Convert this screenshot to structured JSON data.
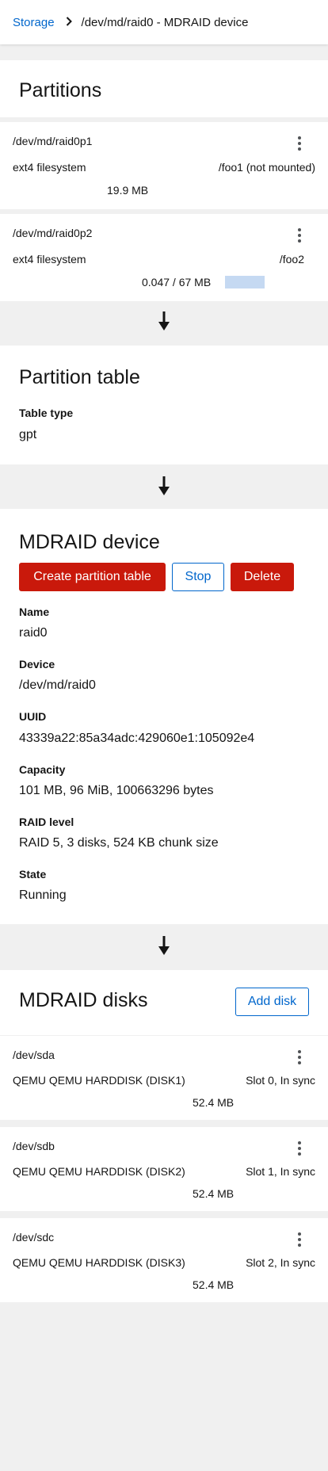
{
  "breadcrumb": {
    "root": "Storage",
    "current": "/dev/md/raid0 - MDRAID device"
  },
  "partitions": {
    "title": "Partitions",
    "items": [
      {
        "name": "/dev/md/raid0p1",
        "type": "ext4 filesystem",
        "mount": "/foo1 (not mounted)",
        "size": "19.9 MB",
        "usage": null
      },
      {
        "name": "/dev/md/raid0p2",
        "type": "ext4 filesystem",
        "mount": "/foo2",
        "size": "0.047 / 67 MB",
        "usage": 0.001
      }
    ]
  },
  "partition_table": {
    "title": "Partition table",
    "type_label": "Table type",
    "type_value": "gpt"
  },
  "mdraid_device": {
    "title": "MDRAID device",
    "buttons": {
      "create": "Create partition table",
      "stop": "Stop",
      "delete": "Delete"
    },
    "fields": [
      {
        "label": "Name",
        "value": "raid0"
      },
      {
        "label": "Device",
        "value": "/dev/md/raid0"
      },
      {
        "label": "UUID",
        "value": "43339a22:85a34adc:429060e1:105092e4"
      },
      {
        "label": "Capacity",
        "value": "101 MB, 96 MiB, 100663296 bytes"
      },
      {
        "label": "RAID level",
        "value": "RAID 5, 3 disks, 524 KB chunk size"
      },
      {
        "label": "State",
        "value": "Running"
      }
    ]
  },
  "mdraid_disks": {
    "title": "MDRAID disks",
    "add_label": "Add disk",
    "items": [
      {
        "name": "/dev/sda",
        "model": "QEMU QEMU HARDDISK (DISK1)",
        "slot": "Slot 0, In sync",
        "size": "52.4 MB"
      },
      {
        "name": "/dev/sdb",
        "model": "QEMU QEMU HARDDISK (DISK2)",
        "slot": "Slot 1, In sync",
        "size": "52.4 MB"
      },
      {
        "name": "/dev/sdc",
        "model": "QEMU QEMU HARDDISK (DISK3)",
        "slot": "Slot 2, In sync",
        "size": "52.4 MB"
      }
    ]
  },
  "colors": {
    "link": "#0066cc",
    "danger": "#c9190b",
    "usage_bar": "#c5d9f2",
    "background": "#f0f0f0"
  }
}
